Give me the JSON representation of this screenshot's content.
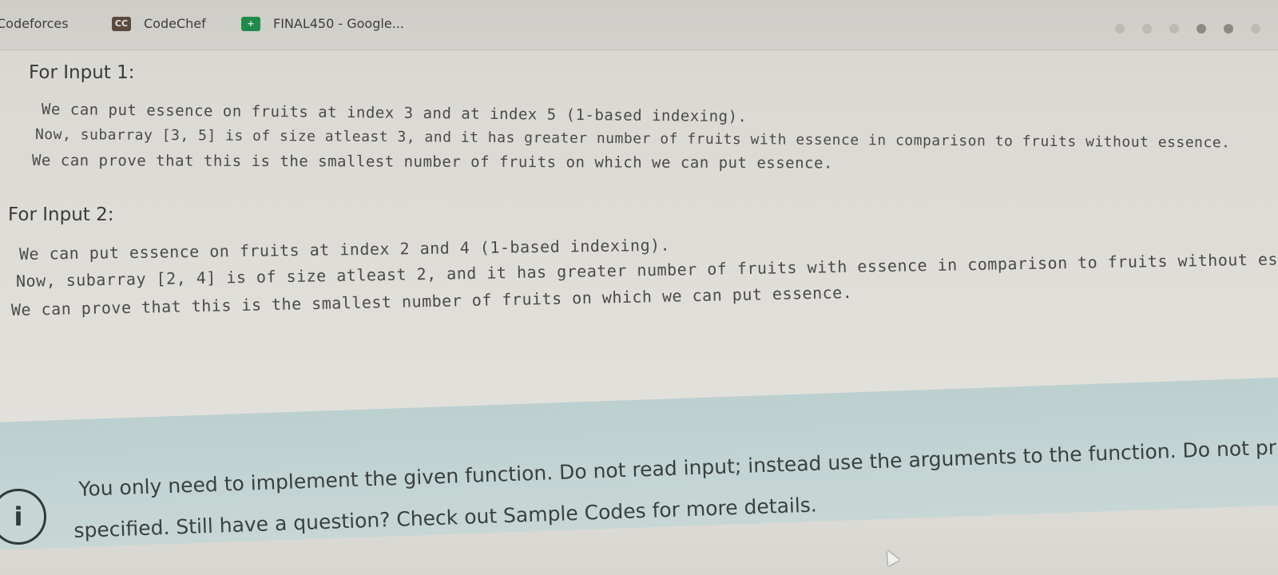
{
  "bookmarks": [
    {
      "label": "Codeforces",
      "icon": "codeforces-icon"
    },
    {
      "label": "CodeChef",
      "icon": "codechef-icon",
      "badge": "CC"
    },
    {
      "label": "FINAL450 - Google...",
      "icon": "google-sheets-icon"
    }
  ],
  "examples": [
    {
      "heading": "For Input 1:",
      "lines": [
        "We can put essence on fruits at index 3 and at index 5 (1-based indexing).",
        "Now, subarray [3, 5] is of size atleast 3, and it has greater number of fruits with essence in comparison to fruits without essence.",
        "We can prove that this is the smallest number of fruits on which we can put essence."
      ]
    },
    {
      "heading": "For Input 2:",
      "lines": [
        "We can put essence on fruits at index 2 and 4 (1-based indexing).",
        "Now, subarray [2, 4] is of size atleast 2, and it has greater number of fruits with essence in comparison to fruits without es",
        "We can prove that this is the smallest number of fruits on which we can put essence."
      ]
    }
  ],
  "info": {
    "icon_glyph": "i",
    "line1": "You only need to implement the given function. Do not read input; instead use the arguments to the function. Do not prir",
    "line2": "specified. Still have a question? Check out Sample Codes for more details."
  },
  "colors": {
    "banner": "#c3d4d3",
    "sheets_icon": "#1f8a4c",
    "codechef_icon": "#5a4a3c"
  }
}
